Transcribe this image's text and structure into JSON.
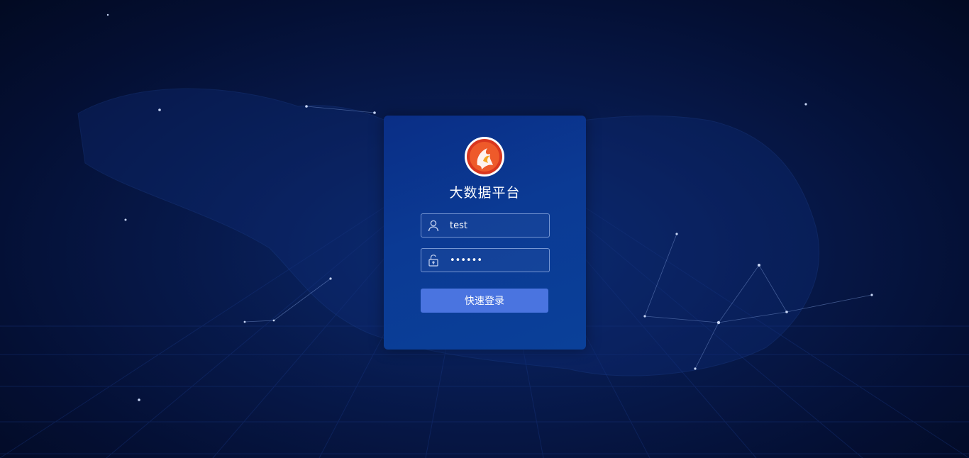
{
  "app": {
    "title": "大数据平台"
  },
  "login": {
    "username_value": "test",
    "password_value": "123456",
    "submit_label": "快速登录"
  },
  "icons": {
    "logo": "phoenix-logo-icon",
    "user": "user-icon",
    "password": "lock-icon"
  },
  "colors": {
    "background": "#040f33",
    "card": "#0b3a94",
    "button": "#4a74e0",
    "text": "#ffffff",
    "logo_primary": "#e03b22",
    "logo_secondary": "#f5a623"
  }
}
